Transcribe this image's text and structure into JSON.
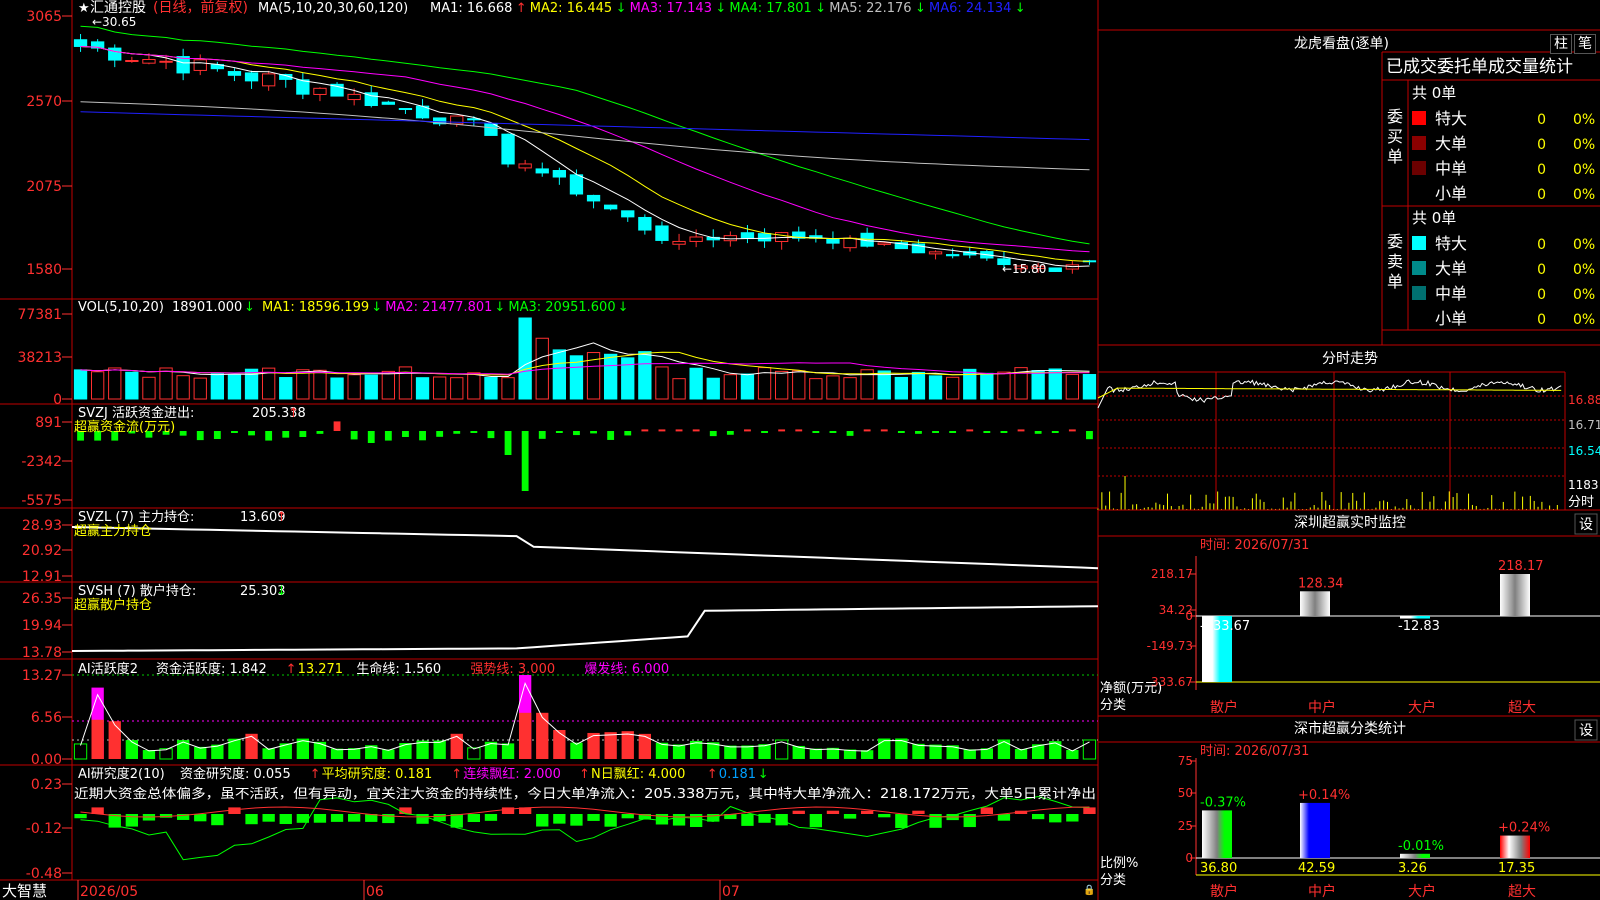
{
  "colors": {
    "up": "#ff3030",
    "down": "#00ffff",
    "axis": "#ff3030",
    "ma1": "#ffffff",
    "ma2": "#ffff00",
    "ma3": "#ff00ff",
    "ma4": "#00ff00",
    "ma5": "#c0c0c0",
    "ma6": "#2020ff",
    "yellow": "#ffff00",
    "green": "#00ff00",
    "magenta": "#ff00ff"
  },
  "stock": {
    "star": "★",
    "name": "汇通控股",
    "period": "(日线，前复权)"
  },
  "kline": {
    "yticks": [
      "3065",
      "2570",
      "2075",
      "1580"
    ],
    "ma_header": "MA(5,10,20,30,60,120)",
    "ma": [
      {
        "label": "MA1:",
        "value": "16.668",
        "arrow": "↑"
      },
      {
        "label": "MA2:",
        "value": "16.445",
        "arrow": "↓"
      },
      {
        "label": "MA3:",
        "value": "17.143",
        "arrow": "↓"
      },
      {
        "label": "MA4:",
        "value": "17.801",
        "arrow": "↓"
      },
      {
        "label": "MA5:",
        "value": "22.176",
        "arrow": "↓"
      },
      {
        "label": "MA6:",
        "value": "24.134",
        "arrow": "↓"
      }
    ],
    "high_mark": "←30.65",
    "low_mark": "←15.80"
  },
  "vol": {
    "yticks": [
      "77381",
      "38213",
      "0"
    ],
    "header": "VOL(5,10,20)",
    "value": "18901.000",
    "arrow": "↓",
    "ma": [
      {
        "label": "MA1:",
        "value": "18596.199",
        "arrow": "↓"
      },
      {
        "label": "MA2:",
        "value": "21477.801",
        "arrow": "↓"
      },
      {
        "label": "MA3:",
        "value": "20951.600",
        "arrow": "↓"
      }
    ]
  },
  "svzj": {
    "yticks": [
      "891",
      "-2342",
      "-5575"
    ],
    "header": "SVZJ  活跃资金进出:",
    "value": "205.338",
    "arrow": "↑",
    "sub": "超赢资金流(万元)"
  },
  "svzl": {
    "yticks": [
      "28.93",
      "20.92",
      "12.91"
    ],
    "header": "SVZL (7) 主力持仓:",
    "value": "13.609",
    "arrow": "↑",
    "sub": "超赢主力持仓"
  },
  "svsh": {
    "yticks": [
      "26.35",
      "19.94",
      "13.78"
    ],
    "header": "SVSH (7) 散户持仓:",
    "value": "25.303",
    "arrow": "↓",
    "sub": "超赢散户持仓"
  },
  "ai1": {
    "yticks": [
      "13.27",
      "6.56",
      "0.00"
    ],
    "title": "AI活跃度2",
    "items": [
      {
        "label": "资金活跃度:",
        "value": "1.842",
        "arrow": "↑"
      },
      {
        "label": "",
        "value": "13.271",
        "arrow": ""
      },
      {
        "label": "生命线:",
        "value": "1.560",
        "arrow": ""
      },
      {
        "label": "强势线:",
        "value": "3.000",
        "arrow": ""
      },
      {
        "label": "爆发线:",
        "value": "6.000",
        "arrow": ""
      }
    ]
  },
  "ai2": {
    "yticks": [
      "0.23",
      "-0.12",
      "-0.48"
    ],
    "title": "AI研究度2(10)",
    "items": [
      {
        "label": "资金研究度:",
        "value": "0.055",
        "arrow": "↑"
      },
      {
        "label": "平均研究度:",
        "value": "0.181",
        "arrow": "↑"
      },
      {
        "label": "连续飘红:",
        "value": "2.000",
        "arrow": "↑"
      },
      {
        "label": "N日飘红:",
        "value": "4.000",
        "arrow": "↑"
      },
      {
        "label": "",
        "value": "0.181",
        "arrow": "↓"
      }
    ],
    "comment": "近期大资金总体偏多，虽不活跃，但有异动，宜关注大资金的持续性，今日大单净流入：205.338万元，其中特大单净流入：218.172万元，大单5日累计净出"
  },
  "xaxis": {
    "labels": [
      "2026/05",
      "06",
      "07"
    ],
    "logo": "大智慧"
  },
  "lhb": {
    "title": "龙虎看盘(逐单)",
    "tab_bar": "柱",
    "tab_pen": "笔",
    "header": "已成交委托单成交量统计",
    "buy": {
      "label": "委买单",
      "total": "共 0单",
      "rows": [
        {
          "name": "特大",
          "count": "0",
          "pct": "0%"
        },
        {
          "name": "大单",
          "count": "0",
          "pct": "0%"
        },
        {
          "name": "中单",
          "count": "0",
          "pct": "0%"
        },
        {
          "name": "小单",
          "count": "0",
          "pct": "0%"
        }
      ]
    },
    "sell": {
      "label": "委卖单",
      "total": "共 0单",
      "rows": [
        {
          "name": "特大",
          "count": "0",
          "pct": "0%"
        },
        {
          "name": "大单",
          "count": "0",
          "pct": "0%"
        },
        {
          "name": "中单",
          "count": "0",
          "pct": "0%"
        },
        {
          "name": "小单",
          "count": "0",
          "pct": "0%"
        }
      ]
    }
  },
  "intraday": {
    "title": "分时走势",
    "prices": [
      "16.88",
      "16.71",
      "16.54"
    ],
    "vol": "1183",
    "label": "分时"
  },
  "monitor": {
    "title": "深圳超赢实时监控",
    "set": "设",
    "time": "时间: 2026/07/31",
    "yticks": [
      "218.17",
      "34.22",
      "0",
      "-149.73",
      "-333.67"
    ],
    "ylabel": "净额(万元)",
    "xlabel": "分类",
    "categories": [
      "散户",
      "中户",
      "大户",
      "超大"
    ],
    "values": [
      -333.67,
      128.34,
      -12.83,
      218.17
    ],
    "value_labels": [
      "-333.67",
      "128.34",
      "-12.83",
      "218.17"
    ]
  },
  "classify": {
    "title": "深市超赢分类统计",
    "set": "设",
    "time": "时间: 2026/07/31",
    "yticks": [
      "75",
      "50",
      "25",
      "0"
    ],
    "ylabel": "比例%",
    "xlabel": "分类",
    "categories": [
      "散户",
      "中户",
      "大户",
      "超大"
    ],
    "values": [
      36.8,
      42.59,
      3.26,
      17.35
    ],
    "value_labels": [
      "36.80",
      "42.59",
      "3.26",
      "17.35"
    ],
    "changes": [
      "-0.37%",
      "+0.14%",
      "-0.01%",
      "+0.24%"
    ]
  },
  "chart_data": [
    {
      "type": "bar",
      "title": "深圳超赢实时监控",
      "ylabel": "净额(万元)",
      "xlabel": "分类",
      "categories": [
        "散户",
        "中户",
        "大户",
        "超大"
      ],
      "values": [
        -333.67,
        128.34,
        -12.83,
        218.17
      ],
      "ylim": [
        -333.67,
        218.17
      ]
    },
    {
      "type": "bar",
      "title": "深市超赢分类统计",
      "ylabel": "比例%",
      "xlabel": "分类",
      "categories": [
        "散户",
        "中户",
        "大户",
        "超大"
      ],
      "values": [
        36.8,
        42.59,
        3.26,
        17.35
      ],
      "ylim": [
        0,
        75
      ]
    }
  ]
}
